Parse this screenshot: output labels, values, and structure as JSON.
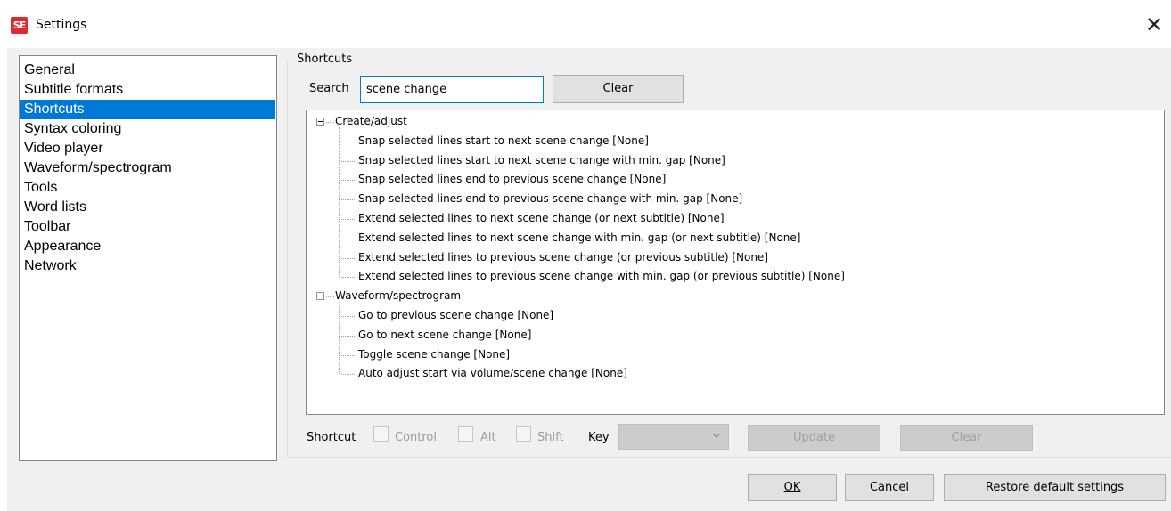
{
  "window": {
    "title": "Settings",
    "icon_text": "SE",
    "close_glyph": "✕"
  },
  "nav": {
    "items": [
      {
        "label": "General",
        "selected": false
      },
      {
        "label": "Subtitle formats",
        "selected": false
      },
      {
        "label": "Shortcuts",
        "selected": true
      },
      {
        "label": "Syntax coloring",
        "selected": false
      },
      {
        "label": "Video player",
        "selected": false
      },
      {
        "label": "Waveform/spectrogram",
        "selected": false
      },
      {
        "label": "Tools",
        "selected": false
      },
      {
        "label": "Word lists",
        "selected": false
      },
      {
        "label": "Toolbar",
        "selected": false
      },
      {
        "label": "Appearance",
        "selected": false
      },
      {
        "label": "Network",
        "selected": false
      }
    ]
  },
  "shortcuts": {
    "group_label": "Shortcuts",
    "search_label": "Search",
    "search_value": "scene change",
    "clear_label": "Clear",
    "tree": [
      {
        "label": "Create/adjust",
        "expanded": true,
        "children": [
          "Snap selected lines start to next scene change [None]",
          "Snap selected lines start to next scene change with min. gap [None]",
          "Snap selected lines end to previous scene change [None]",
          "Snap selected lines end to previous scene change with min. gap [None]",
          "Extend selected lines to next scene change (or next subtitle) [None]",
          "Extend selected lines to next scene change with min. gap (or next subtitle) [None]",
          "Extend selected lines to previous scene change (or previous subtitle) [None]",
          "Extend selected lines to previous scene change with min. gap (or previous subtitle) [None]"
        ]
      },
      {
        "label": "Waveform/spectrogram",
        "expanded": true,
        "children": [
          "Go to previous scene change [None]",
          "Go to next scene change [None]",
          "Toggle scene change [None]",
          "Auto adjust start via volume/scene change [None]"
        ]
      }
    ],
    "shortcut_label": "Shortcut",
    "control_label": "Control",
    "alt_label": "Alt",
    "shift_label": "Shift",
    "key_label": "Key",
    "key_value": "",
    "update_label": "Update",
    "clear2_label": "Clear"
  },
  "footer": {
    "ok_label": "OK",
    "cancel_label": "Cancel",
    "restore_label": "Restore default settings"
  },
  "colors": {
    "selection": "#0078d7",
    "window_bg": "#f0f0f0",
    "disabled_text": "#a0a0a0",
    "app_icon": "#e0282f"
  }
}
